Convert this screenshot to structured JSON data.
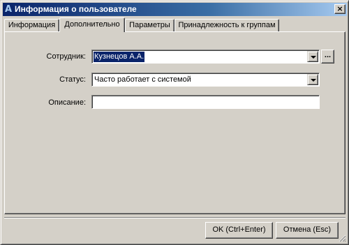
{
  "window": {
    "title": "Информация о пользователе",
    "close_glyph": "×"
  },
  "tabs": [
    {
      "label": "Информация",
      "active": false
    },
    {
      "label": "Дополнительно",
      "active": true
    },
    {
      "label": "Параметры",
      "active": false
    },
    {
      "label": "Принадлежность к группам",
      "active": false
    }
  ],
  "form": {
    "employee": {
      "label": "Сотрудник:",
      "value": "Кузнецов А.А.",
      "browse_label": "..."
    },
    "status": {
      "label": "Статус:",
      "value": "Часто работает с системой"
    },
    "description": {
      "label": "Описание:",
      "value": ""
    }
  },
  "buttons": {
    "ok": "OK (Ctrl+Enter)",
    "cancel": "Отмена (Esc)"
  },
  "colors": {
    "title_gradient_start": "#0a246a",
    "title_gradient_end": "#a6caf0",
    "face": "#d4d0c8",
    "selection": "#0a246a"
  }
}
